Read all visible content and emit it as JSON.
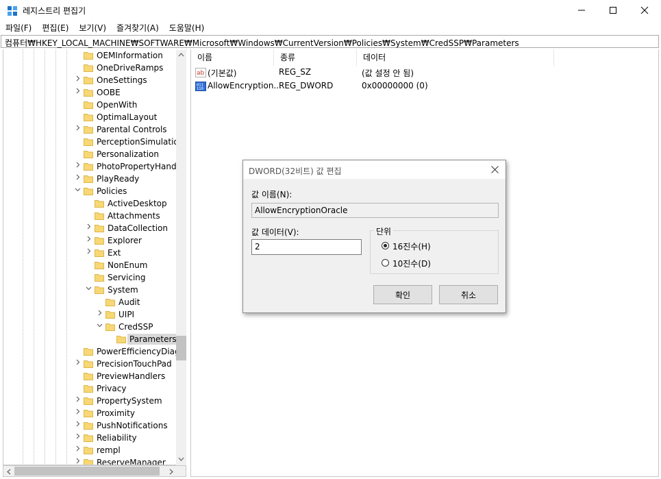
{
  "window": {
    "title": "레지스트리 편집기",
    "controls": {
      "minimize": "—",
      "maximize": "☐",
      "close": "✕"
    }
  },
  "menu": [
    "파일(F)",
    "편집(E)",
    "보기(V)",
    "즐겨찾기(A)",
    "도움말(H)"
  ],
  "address": "컴퓨터₩HKEY_LOCAL_MACHINE₩SOFTWARE₩Microsoft₩Windows₩CurrentVersion₩Policies₩System₩CredSSP₩Parameters",
  "tree": {
    "items": [
      {
        "label": "OEMInformation",
        "level": 0,
        "expander": ""
      },
      {
        "label": "OneDriveRamps",
        "level": 0,
        "expander": ""
      },
      {
        "label": "OneSettings",
        "level": 0,
        "expander": ">"
      },
      {
        "label": "OOBE",
        "level": 0,
        "expander": ">"
      },
      {
        "label": "OpenWith",
        "level": 0,
        "expander": ""
      },
      {
        "label": "OptimalLayout",
        "level": 0,
        "expander": ""
      },
      {
        "label": "Parental Controls",
        "level": 0,
        "expander": ">"
      },
      {
        "label": "PerceptionSimulation",
        "level": 0,
        "expander": ""
      },
      {
        "label": "Personalization",
        "level": 0,
        "expander": ""
      },
      {
        "label": "PhotoPropertyHandle",
        "level": 0,
        "expander": ">"
      },
      {
        "label": "PlayReady",
        "level": 0,
        "expander": ">"
      },
      {
        "label": "Policies",
        "level": 0,
        "expander": "v"
      },
      {
        "label": "ActiveDesktop",
        "level": 1,
        "expander": ""
      },
      {
        "label": "Attachments",
        "level": 1,
        "expander": ""
      },
      {
        "label": "DataCollection",
        "level": 1,
        "expander": ">"
      },
      {
        "label": "Explorer",
        "level": 1,
        "expander": ">"
      },
      {
        "label": "Ext",
        "level": 1,
        "expander": ">"
      },
      {
        "label": "NonEnum",
        "level": 1,
        "expander": ""
      },
      {
        "label": "Servicing",
        "level": 1,
        "expander": ""
      },
      {
        "label": "System",
        "level": 1,
        "expander": "v"
      },
      {
        "label": "Audit",
        "level": 2,
        "expander": ""
      },
      {
        "label": "UIPI",
        "level": 2,
        "expander": ">"
      },
      {
        "label": "CredSSP",
        "level": 2,
        "expander": "v"
      },
      {
        "label": "Parameters",
        "level": 3,
        "expander": "",
        "selected": true
      },
      {
        "label": "PowerEfficiencyDiagn",
        "level": 0,
        "expander": ""
      },
      {
        "label": "PrecisionTouchPad",
        "level": 0,
        "expander": ">"
      },
      {
        "label": "PreviewHandlers",
        "level": 0,
        "expander": ""
      },
      {
        "label": "Privacy",
        "level": 0,
        "expander": ""
      },
      {
        "label": "PropertySystem",
        "level": 0,
        "expander": ">"
      },
      {
        "label": "Proximity",
        "level": 0,
        "expander": ">"
      },
      {
        "label": "PushNotifications",
        "level": 0,
        "expander": ">"
      },
      {
        "label": "Reliability",
        "level": 0,
        "expander": ">"
      },
      {
        "label": "rempl",
        "level": 0,
        "expander": ">"
      },
      {
        "label": "ReserveManager",
        "level": 0,
        "expander": ">"
      }
    ]
  },
  "list": {
    "columns": [
      "이름",
      "종류",
      "데이터"
    ],
    "rows": [
      {
        "icon": "string-value-icon",
        "name": "(기본값)",
        "type": "REG_SZ",
        "data": "(값 설정 안 됨)"
      },
      {
        "icon": "dword-value-icon",
        "name": "AllowEncryption...",
        "type": "REG_DWORD",
        "data": "0x00000000 (0)"
      }
    ]
  },
  "dialog": {
    "title": "DWORD(32비트) 값 편집",
    "value_name_label": "값 이름(N):",
    "value_name": "AllowEncryptionOracle",
    "value_data_label": "값 데이터(V):",
    "value_data": "2",
    "base_group_label": "단위",
    "base_hex_label": "16진수(H)",
    "base_dec_label": "10진수(D)",
    "base_selected": "hex",
    "ok_label": "확인",
    "cancel_label": "취소",
    "close_glyph": "✕"
  },
  "colors": {
    "accent": "#0078d7",
    "folder": "#f8d775",
    "folder_edge": "#dcb64a"
  }
}
